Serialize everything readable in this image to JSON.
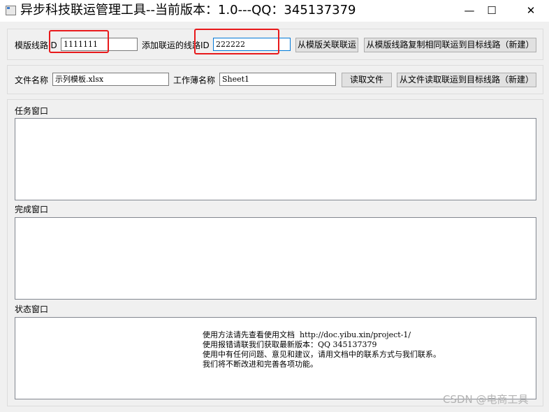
{
  "window": {
    "title": "异步科技联运管理工具--当前版本：1.0---QQ：345137379",
    "minimize_glyph": "—",
    "maximize_glyph": "☐",
    "close_glyph": "✕"
  },
  "row1": {
    "template_line_label": "模版线路ID",
    "template_line_value": "1111111",
    "target_line_label": "添加联运的线路ID",
    "target_line_value": "222222",
    "link_button": "从模版关联联运",
    "copy_button": "从模版线路复制相同联运到目标线路（新建）"
  },
  "row2": {
    "file_label": "文件名称",
    "file_value": "示列模板.xlsx",
    "sheet_label": "工作薄名称",
    "sheet_value": "Sheet1",
    "read_button": "读取文件",
    "read_link_button": "从文件读取联运到目标线路（新建）"
  },
  "panes": {
    "task_label": "任务窗口",
    "done_label": "完成窗口",
    "status_label": "状态窗口",
    "status_lines": [
      "使用方法请先查看使用文档  http://doc.yibu.xin/project-1/",
      "使用报错请联我们获取最新版本：QQ 345137379",
      "使用中有任何问题、意见和建议，请用文档中的联系方式与我们联系。",
      "我们将不断改进和完善各项功能。"
    ]
  },
  "watermark": "CSDN @电商工具"
}
